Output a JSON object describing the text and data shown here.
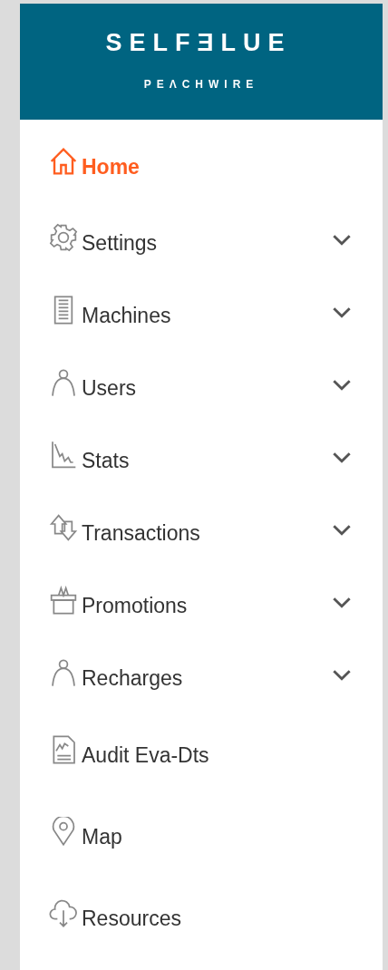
{
  "brand": {
    "logo": "SELFƎLUE",
    "sublogo": "PEΛCHWIRE"
  },
  "menu": [
    {
      "label": "Home",
      "kind": "link",
      "selected": true
    },
    {
      "label": "Settings",
      "kind": "group",
      "selected": false,
      "expanded": false
    },
    {
      "label": "Machines",
      "kind": "group",
      "selected": false,
      "expanded": false
    },
    {
      "label": "Users",
      "kind": "group",
      "selected": false,
      "expanded": false
    },
    {
      "label": "Stats",
      "kind": "group",
      "selected": false,
      "expanded": false
    },
    {
      "label": "Transactions",
      "kind": "group",
      "selected": false,
      "expanded": false
    },
    {
      "label": "Promotions",
      "kind": "group",
      "selected": false,
      "expanded": false
    },
    {
      "label": "Recharges",
      "kind": "group",
      "selected": false,
      "expanded": false
    },
    {
      "label": "Audit Eva-Dts",
      "kind": "link",
      "selected": false
    },
    {
      "label": "Map",
      "kind": "link",
      "selected": false
    },
    {
      "label": "Resources",
      "kind": "link",
      "selected": false
    }
  ]
}
